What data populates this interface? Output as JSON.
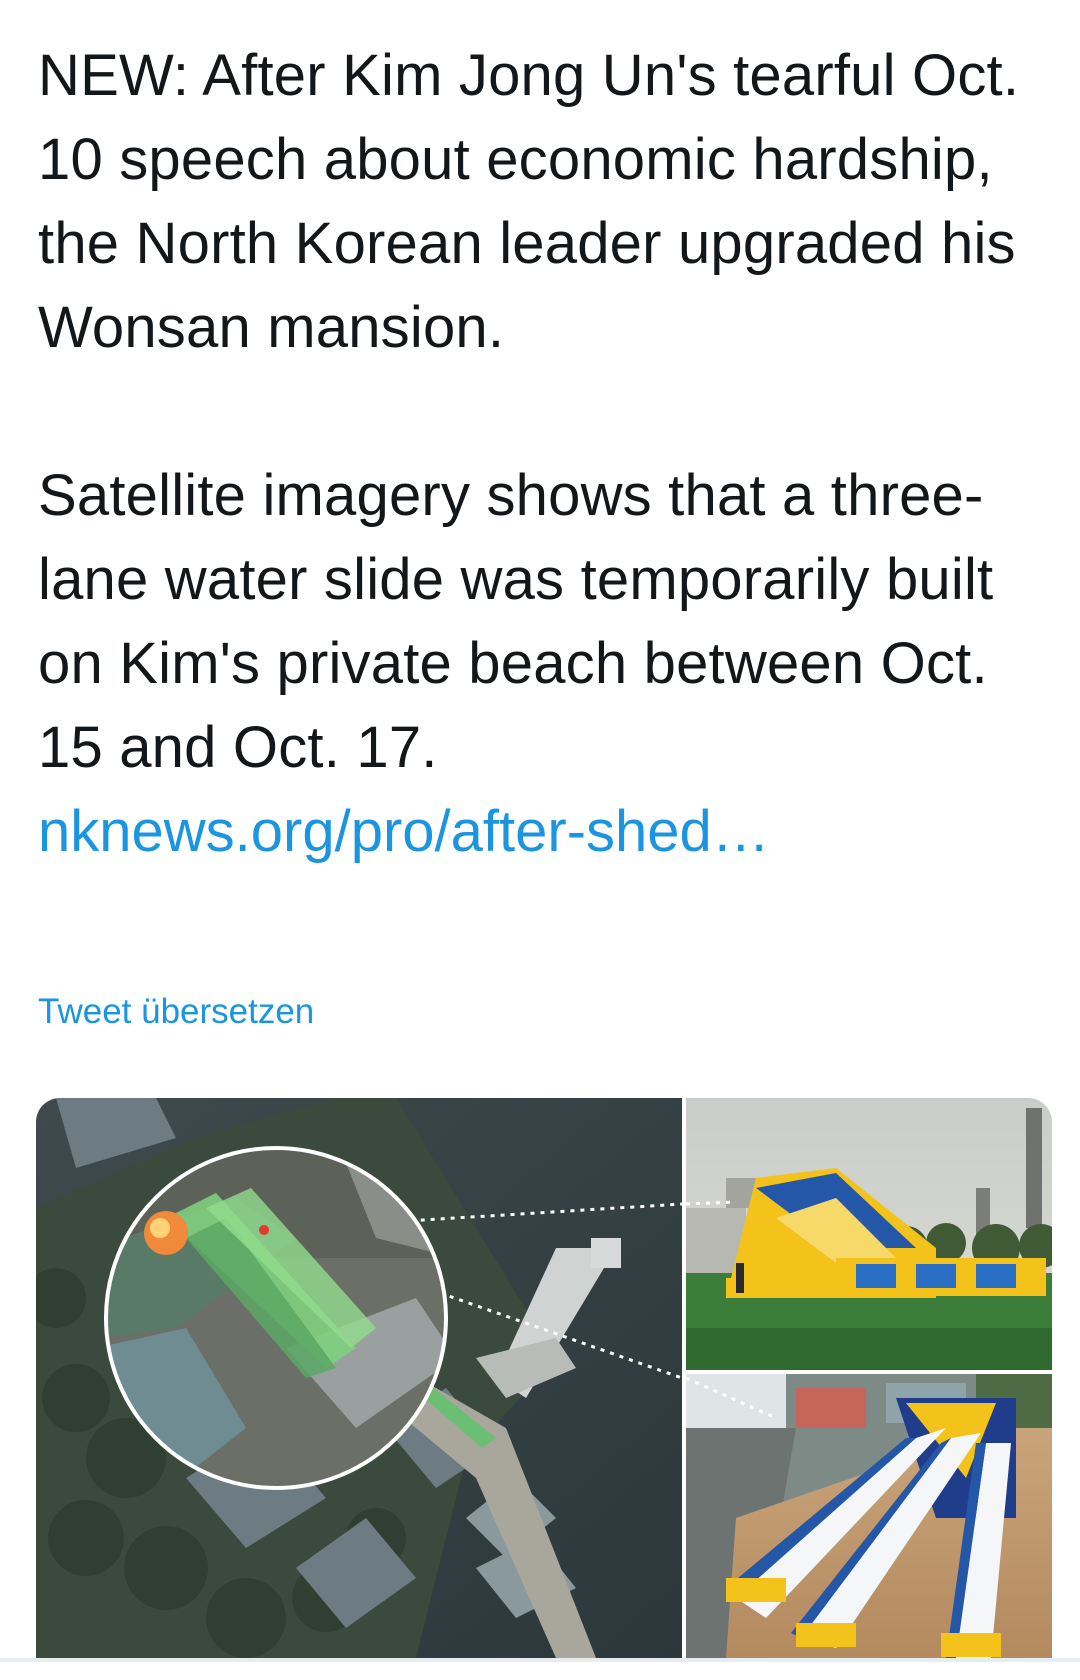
{
  "tweet": {
    "paragraph_1": "NEW: After Kim Jong Un's tearful Oct. 10 speech about economic hardship, the North Korean leader upgraded his Wonsan mansion.",
    "paragraph_2": "Satellite imagery shows that a three-lane water slide was temporarily built on Kim's private beach between Oct. 15 and Oct. 17.",
    "link": "nknews.org/pro/after-shed…",
    "translate_label": "Tweet übersetzen"
  },
  "media": {
    "icons": [
      "satellite-image",
      "magnifier-circle",
      "inflatable-slide-photo",
      "three-lane-slide-photo"
    ],
    "colors": {
      "link": "#1b95e0",
      "slide_green": "#59b36a",
      "slide_yellow": "#f3c21b",
      "slide_blue": "#2457a8"
    }
  }
}
